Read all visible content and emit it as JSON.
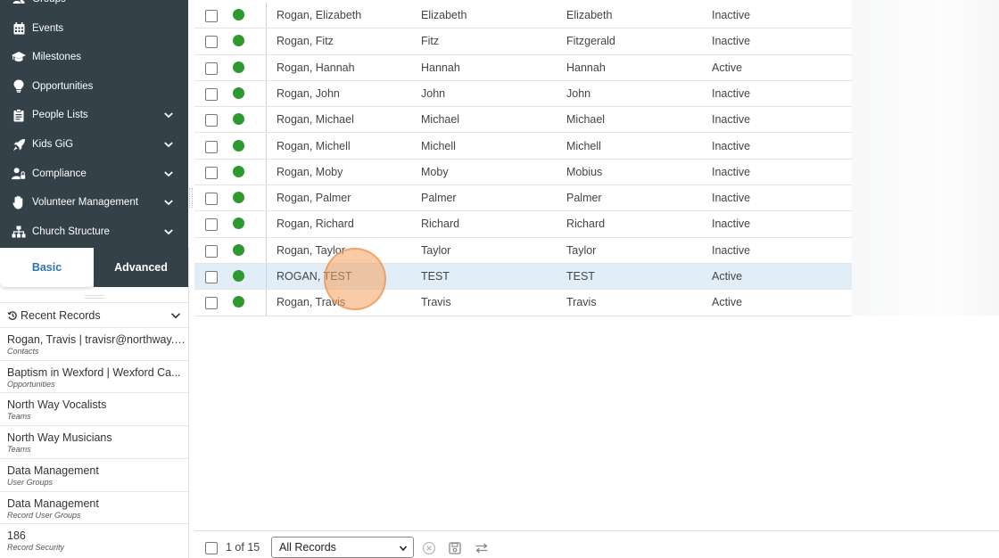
{
  "sidebar": {
    "nav": [
      {
        "label": "Groups",
        "icon": "groups-icon",
        "chevron": false
      },
      {
        "label": "Events",
        "icon": "calendar-icon",
        "chevron": false
      },
      {
        "label": "Milestones",
        "icon": "graduation-cap-icon",
        "chevron": false
      },
      {
        "label": "Opportunities",
        "icon": "lightbulb-icon",
        "chevron": false
      },
      {
        "label": "People Lists",
        "icon": "clipboard-icon",
        "chevron": true
      },
      {
        "label": "Kids GiG",
        "icon": "rocket-icon",
        "chevron": true
      },
      {
        "label": "Compliance",
        "icon": "user-lock-icon",
        "chevron": true
      },
      {
        "label": "Volunteer Management",
        "icon": "hand-icon",
        "chevron": true
      },
      {
        "label": "Church Structure",
        "icon": "sitemap-icon",
        "chevron": true
      }
    ],
    "tabs": {
      "basic": "Basic",
      "advanced": "Advanced"
    },
    "recent": {
      "title": "Recent Records",
      "items": [
        {
          "name": "Rogan, Travis | travisr@northway.o...",
          "type": "Contacts"
        },
        {
          "name": "Baptism in Wexford | Wexford Ca...",
          "type": "Opportunities"
        },
        {
          "name": "North Way Vocalists",
          "type": "Teams"
        },
        {
          "name": "North Way Musicians",
          "type": "Teams"
        },
        {
          "name": "Data Management",
          "type": "User Groups"
        },
        {
          "name": "Data Management",
          "type": "Record User Groups"
        },
        {
          "name": "186",
          "type": "Record Security"
        }
      ]
    }
  },
  "grid": {
    "rows": [
      {
        "display": "Rogan, Elizabeth",
        "first": "Elizabeth",
        "nickname": "Elizabeth",
        "status": "Inactive",
        "selected": false
      },
      {
        "display": "Rogan, Fitz",
        "first": "Fitz",
        "nickname": "Fitzgerald",
        "status": "Inactive",
        "selected": false
      },
      {
        "display": "Rogan, Hannah",
        "first": "Hannah",
        "nickname": "Hannah",
        "status": "Active",
        "selected": false
      },
      {
        "display": "Rogan, John",
        "first": "John",
        "nickname": "John",
        "status": "Inactive",
        "selected": false
      },
      {
        "display": "Rogan, Michael",
        "first": "Michael",
        "nickname": "Michael",
        "status": "Inactive",
        "selected": false
      },
      {
        "display": "Rogan, Michell",
        "first": "Michell",
        "nickname": "Michell",
        "status": "Inactive",
        "selected": false
      },
      {
        "display": "Rogan, Moby",
        "first": "Moby",
        "nickname": "Mobius",
        "status": "Inactive",
        "selected": false
      },
      {
        "display": "Rogan, Palmer",
        "first": "Palmer",
        "nickname": "Palmer",
        "status": "Inactive",
        "selected": false
      },
      {
        "display": "Rogan, Richard",
        "first": "Richard",
        "nickname": "Richard",
        "status": "Inactive",
        "selected": false
      },
      {
        "display": "Rogan, Taylor",
        "first": "Taylor",
        "nickname": "Taylor",
        "status": "Inactive",
        "selected": false
      },
      {
        "display": "ROGAN, TEST",
        "first": "TEST",
        "nickname": "TEST",
        "status": "Active",
        "selected": true
      },
      {
        "display": "Rogan, Travis",
        "first": "Travis",
        "nickname": "Travis",
        "status": "Active",
        "selected": false
      }
    ],
    "status_dot_color": "#2c9a2f"
  },
  "footer": {
    "count": "1 of 15",
    "view_select": "All Records",
    "view_options": [
      "All Records"
    ]
  },
  "colors": {
    "nav_bg": "#344148",
    "accent": "#2e74b5",
    "selected_row": "#e2eef7"
  }
}
